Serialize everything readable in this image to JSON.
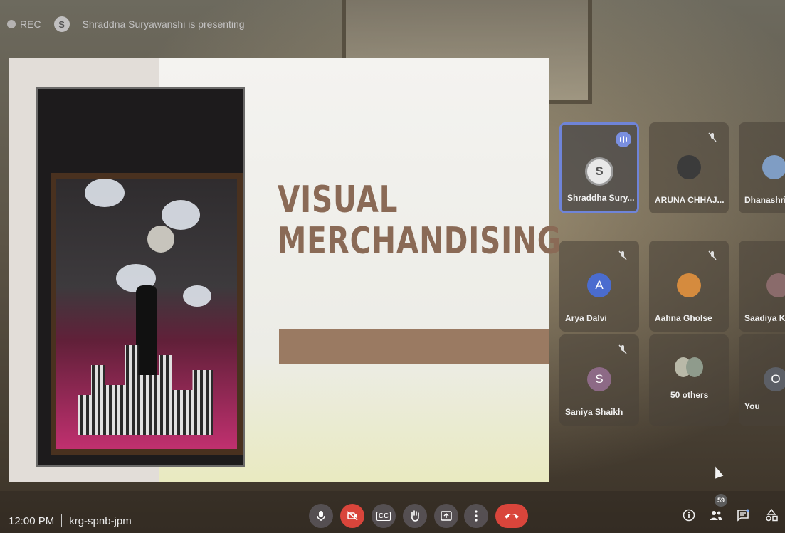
{
  "recording": {
    "label": "REC"
  },
  "presenter": {
    "initial": "S",
    "banner": "Shraddna Suryawanshi is presenting"
  },
  "slide": {
    "title_line1": "VISUAL",
    "title_line2": "MERCHANDISING"
  },
  "participants": [
    {
      "name": "Shraddha Sury...",
      "initial": "S",
      "avatar_color": "#e8e8e8",
      "speaking": true
    },
    {
      "name": "ARUNA CHHAJ...",
      "initial": "",
      "avatar_color": "#3b3b3b",
      "muted": true
    },
    {
      "name": "Dhanashri",
      "initial": "",
      "avatar_color": "#7f9dc4"
    },
    {
      "name": "Arya Dalvi",
      "initial": "A",
      "avatar_color": "#4a6ccf",
      "muted": true
    },
    {
      "name": "Aahna Gholse",
      "initial": "",
      "avatar_color": "#d58b3e",
      "muted": true
    },
    {
      "name": "Saadiya Kh",
      "initial": "",
      "avatar_color": "#8a6b6b"
    },
    {
      "name": "Saniya Shaikh",
      "initial": "S",
      "avatar_color": "#8d6a86",
      "muted": true
    },
    {
      "name": "50 others",
      "initial": ""
    },
    {
      "name": "You",
      "initial": "O"
    }
  ],
  "meeting": {
    "time": "12:00 PM",
    "code": "krg-spnb-jpm"
  },
  "controls": {
    "mic": "mic-icon",
    "camera": "camera-off-icon",
    "captions": "CC",
    "hand": "raise-hand-icon",
    "present": "present-icon",
    "more": "more-icon",
    "end": "end-call-icon"
  },
  "right_controls": {
    "people_count": "59"
  },
  "colors": {
    "accent": "#6f84d8",
    "danger": "#d9453b",
    "slide_title": "#8a6a56"
  }
}
